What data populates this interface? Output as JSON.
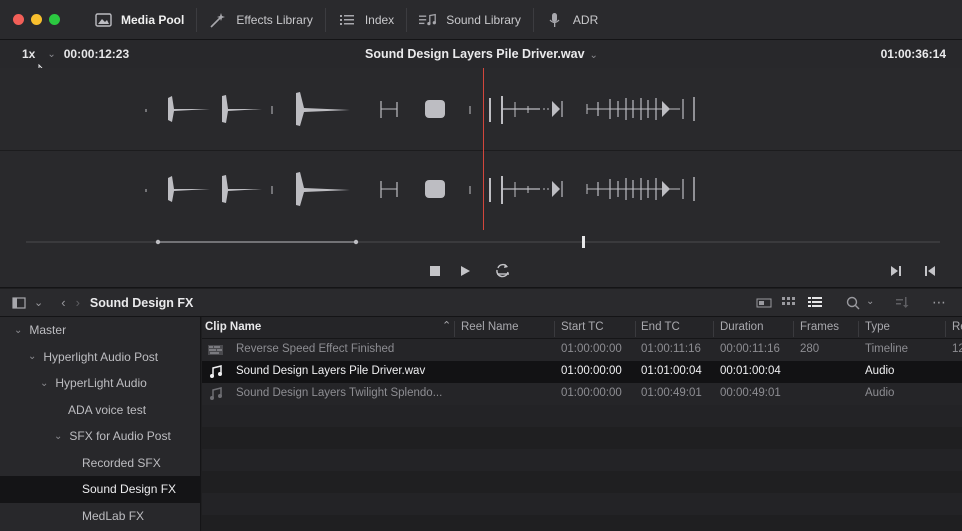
{
  "toolbar": {
    "items": [
      {
        "label": "Media Pool",
        "icon": "media-pool-icon",
        "active": true
      },
      {
        "label": "Effects Library",
        "icon": "effects-library-icon",
        "active": false
      },
      {
        "label": "Index",
        "icon": "index-icon",
        "active": false
      },
      {
        "label": "Sound Library",
        "icon": "sound-library-icon",
        "active": false
      },
      {
        "label": "ADR",
        "icon": "microphone-icon",
        "active": false
      }
    ]
  },
  "viewer": {
    "speed": "1x",
    "timecode_left": "00:00:12:23",
    "clip_name": "Sound Design Layers Pile Driver.wav",
    "timecode_right": "01:00:36:14"
  },
  "pool": {
    "bin_title": "Sound Design FX"
  },
  "sidebar": {
    "items": [
      {
        "label": "Master",
        "depth": 0,
        "expanded": true
      },
      {
        "label": "Hyperlight Audio Post",
        "depth": 1,
        "expanded": true
      },
      {
        "label": "HyperLight Audio",
        "depth": 2,
        "expanded": true
      },
      {
        "label": "ADA voice test",
        "depth": 3,
        "expanded": null
      },
      {
        "label": "SFX for Audio Post",
        "depth": 2,
        "expanded": true
      },
      {
        "label": "Recorded SFX",
        "depth": 4,
        "expanded": null
      },
      {
        "label": "Sound Design FX",
        "depth": 4,
        "expanded": null,
        "selected": true
      },
      {
        "label": "MedLab FX",
        "depth": 4,
        "expanded": null
      }
    ]
  },
  "table": {
    "columns": [
      "Clip Name",
      "Reel Name",
      "Start TC",
      "End TC",
      "Duration",
      "Frames",
      "Type",
      "Re"
    ],
    "rows": [
      {
        "name": "Reverse Speed Effect Finished",
        "icon": "timeline-icon",
        "reel": "",
        "start": "01:00:00:00",
        "end": "01:00:11:16",
        "duration": "00:00:11:16",
        "frames": "280",
        "type": "Timeline",
        "extra": "12"
      },
      {
        "name": "Sound Design Layers Pile Driver.wav",
        "icon": "audio-icon",
        "reel": "",
        "start": "01:00:00:00",
        "end": "01:01:00:04",
        "duration": "00:01:00:04",
        "frames": "",
        "type": "Audio",
        "extra": "",
        "selected": true
      },
      {
        "name": "Sound Design Layers Twilight Splendo...",
        "icon": "audio-icon",
        "reel": "",
        "start": "01:00:00:00",
        "end": "01:00:49:01",
        "duration": "00:00:49:01",
        "frames": "",
        "type": "Audio",
        "extra": ""
      }
    ]
  }
}
